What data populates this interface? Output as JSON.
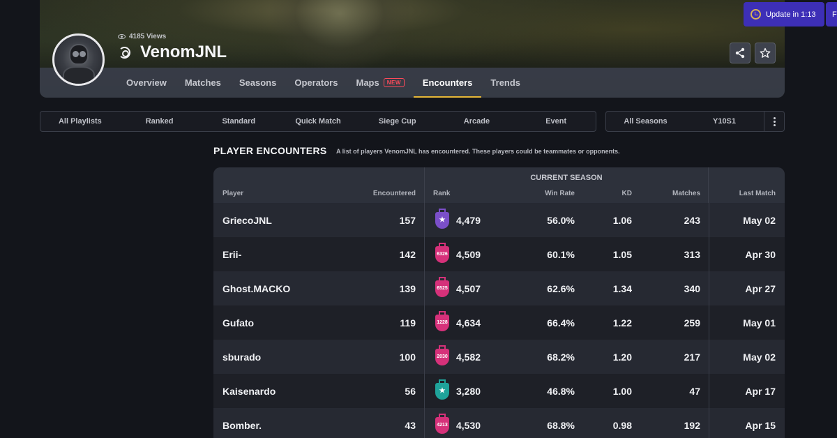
{
  "header": {
    "views": "4185 Views",
    "player_name": "VenomJNL",
    "update_label": "Update in 1:13",
    "update2_label": "F"
  },
  "nav": [
    {
      "label": "Overview"
    },
    {
      "label": "Matches"
    },
    {
      "label": "Seasons"
    },
    {
      "label": "Operators"
    },
    {
      "label": "Maps",
      "badge": "NEW"
    },
    {
      "label": "Encounters",
      "active": true
    },
    {
      "label": "Trends"
    }
  ],
  "playlists": [
    "All Playlists",
    "Ranked",
    "Standard",
    "Quick Match",
    "Siege Cup",
    "Arcade",
    "Event"
  ],
  "seasons": [
    "All Seasons",
    "Y10S1"
  ],
  "section": {
    "title": "PLAYER ENCOUNTERS",
    "description": "A list of players VenomJNL has encountered. These players could be teammates or opponents."
  },
  "table": {
    "group_title": "CURRENT SEASON",
    "columns": {
      "player": "Player",
      "encountered": "Encountered",
      "rank": "Rank",
      "win_rate": "Win Rate",
      "kd": "KD",
      "matches": "Matches",
      "last_match": "Last Match"
    },
    "rows": [
      {
        "player": "GriecoJNL",
        "encountered": "157",
        "rank_badge": "",
        "rank_tier": "champion",
        "rank": "4,479",
        "win_rate": "56.0%",
        "kd": "1.06",
        "matches": "243",
        "last_match": "May 02"
      },
      {
        "player": "Erii-",
        "encountered": "142",
        "rank_badge": "6326",
        "rank_tier": "champion-pink",
        "rank": "4,509",
        "win_rate": "60.1%",
        "kd": "1.05",
        "matches": "313",
        "last_match": "Apr 30"
      },
      {
        "player": "Ghost.MACKO",
        "encountered": "139",
        "rank_badge": "6525",
        "rank_tier": "champion-pink",
        "rank": "4,507",
        "win_rate": "62.6%",
        "kd": "1.34",
        "matches": "340",
        "last_match": "Apr 27"
      },
      {
        "player": "Gufato",
        "encountered": "119",
        "rank_badge": "1228",
        "rank_tier": "champion-pink",
        "rank": "4,634",
        "win_rate": "66.4%",
        "kd": "1.22",
        "matches": "259",
        "last_match": "May 01"
      },
      {
        "player": "sburado",
        "encountered": "100",
        "rank_badge": "2030",
        "rank_tier": "champion-pink",
        "rank": "4,582",
        "win_rate": "68.2%",
        "kd": "1.20",
        "matches": "217",
        "last_match": "May 02"
      },
      {
        "player": "Kaisenardo",
        "encountered": "56",
        "rank_badge": "",
        "rank_tier": "emerald",
        "rank": "3,280",
        "win_rate": "46.8%",
        "kd": "1.00",
        "matches": "47",
        "last_match": "Apr 17"
      },
      {
        "player": "Bomber.",
        "encountered": "43",
        "rank_badge": "4213",
        "rank_tier": "champion-pink",
        "rank": "4,530",
        "win_rate": "68.8%",
        "kd": "0.98",
        "matches": "192",
        "last_match": "Apr 15"
      }
    ]
  },
  "colors": {
    "accent": "#e6b737",
    "update_button": "#3d2fb7",
    "new_badge": "#ff4a5a",
    "rank_champion": "#7b4fc9",
    "rank_champion_pink": "#d6317a",
    "rank_emerald": "#1fa39a"
  }
}
